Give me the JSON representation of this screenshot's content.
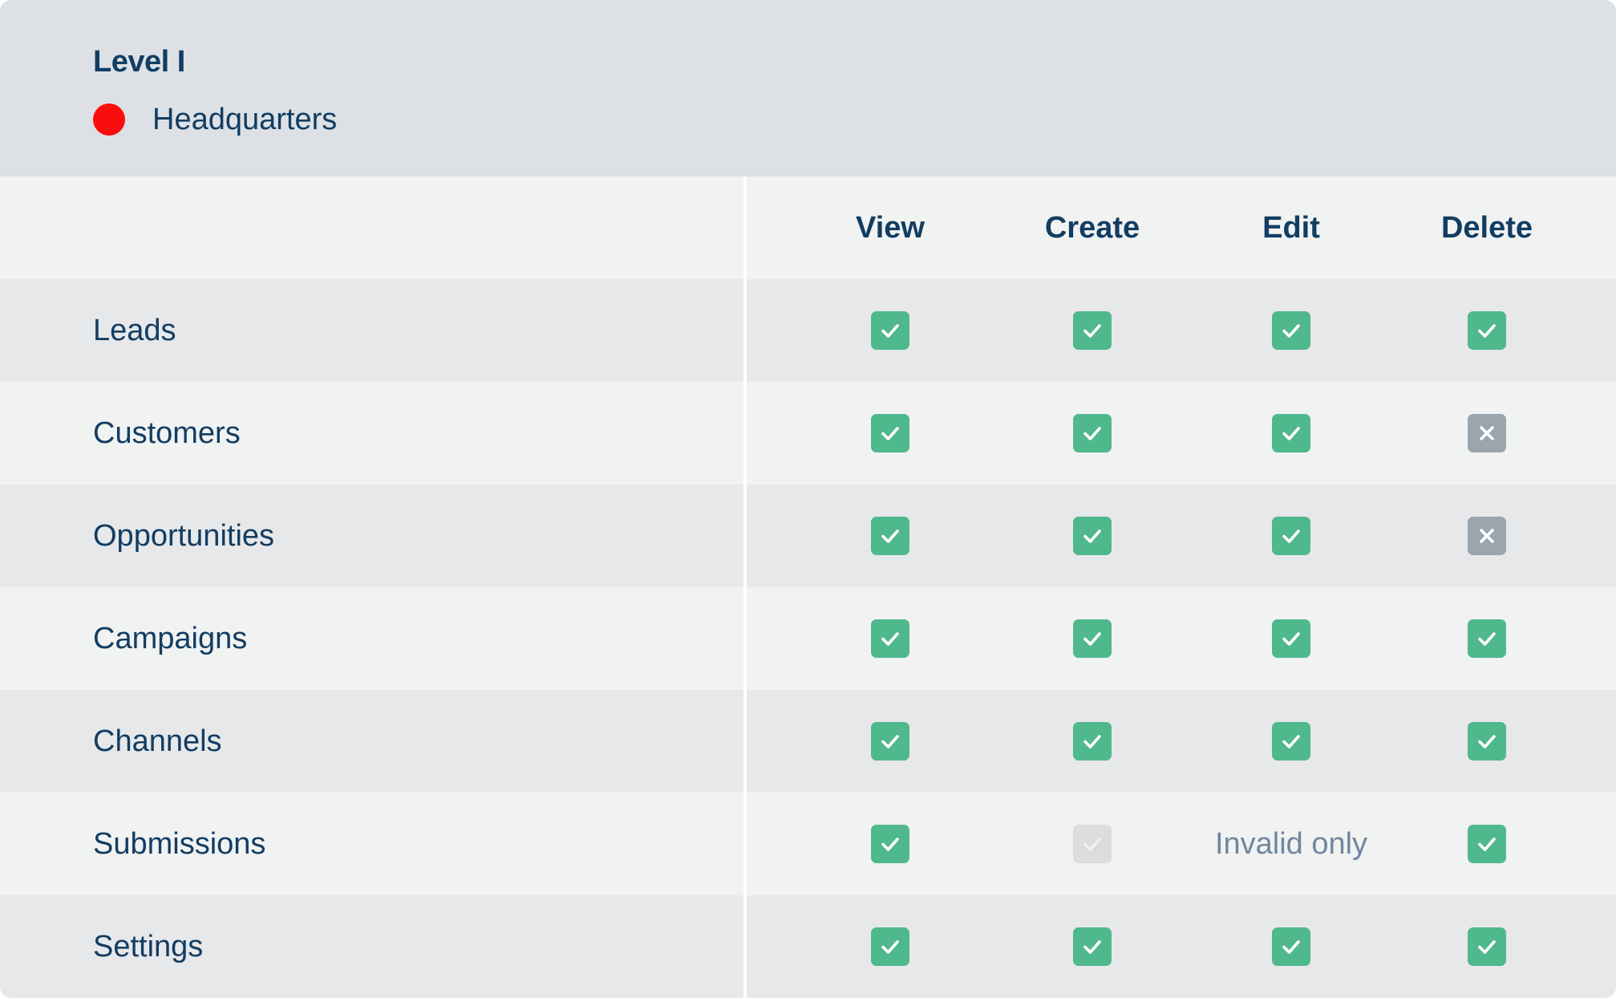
{
  "header": {
    "level_title": "Level I",
    "location_label": "Headquarters",
    "location_color": "#fc0d0d"
  },
  "columns": [
    {
      "label": "View"
    },
    {
      "label": "Create"
    },
    {
      "label": "Edit"
    },
    {
      "label": "Delete"
    }
  ],
  "rows": [
    {
      "label": "Leads",
      "cells": [
        {
          "state": "allowed"
        },
        {
          "state": "allowed"
        },
        {
          "state": "allowed"
        },
        {
          "state": "allowed"
        }
      ]
    },
    {
      "label": "Customers",
      "cells": [
        {
          "state": "allowed"
        },
        {
          "state": "allowed"
        },
        {
          "state": "allowed"
        },
        {
          "state": "denied"
        }
      ]
    },
    {
      "label": "Opportunities",
      "cells": [
        {
          "state": "allowed"
        },
        {
          "state": "allowed"
        },
        {
          "state": "allowed"
        },
        {
          "state": "denied"
        }
      ]
    },
    {
      "label": "Campaigns",
      "cells": [
        {
          "state": "allowed"
        },
        {
          "state": "allowed"
        },
        {
          "state": "allowed"
        },
        {
          "state": "allowed"
        }
      ]
    },
    {
      "label": "Channels",
      "cells": [
        {
          "state": "allowed"
        },
        {
          "state": "allowed"
        },
        {
          "state": "allowed"
        },
        {
          "state": "allowed"
        }
      ]
    },
    {
      "label": "Submissions",
      "cells": [
        {
          "state": "allowed"
        },
        {
          "state": "disabled"
        },
        {
          "state": "text",
          "text": "Invalid only"
        },
        {
          "state": "allowed"
        }
      ]
    },
    {
      "label": "Settings",
      "cells": [
        {
          "state": "allowed"
        },
        {
          "state": "allowed"
        },
        {
          "state": "allowed"
        },
        {
          "state": "allowed"
        }
      ]
    }
  ],
  "colors": {
    "allowed": "#4fb88c",
    "denied": "#9ba5ae",
    "disabled": "#dadcde",
    "text_primary": "#123d62",
    "text_muted": "#6f879e"
  },
  "icons": {
    "allowed": "check-icon",
    "denied": "close-icon",
    "disabled": "check-icon"
  }
}
